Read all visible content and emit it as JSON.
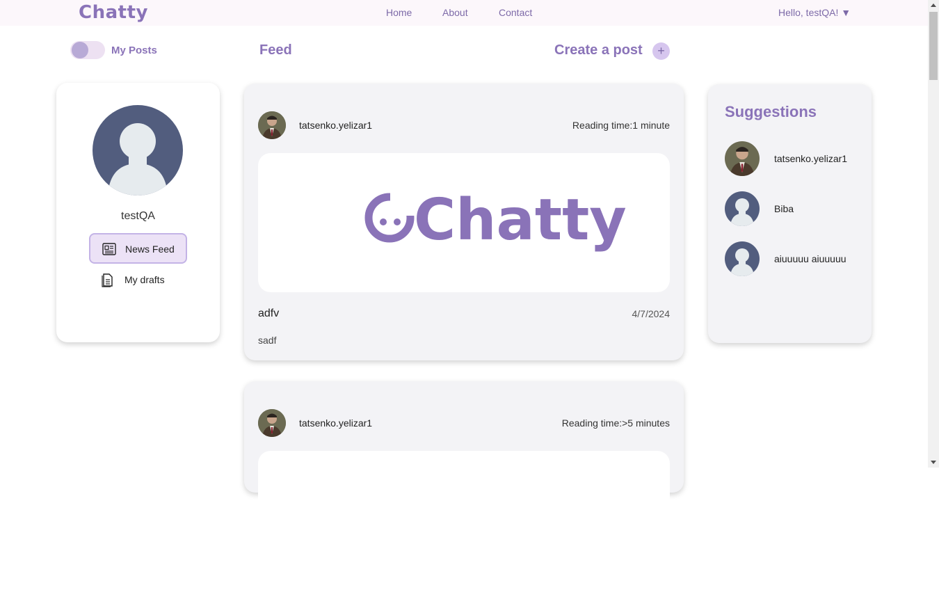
{
  "header": {
    "logo": "Chatty",
    "nav": [
      "Home",
      "About",
      "Contact"
    ],
    "greeting": "Hello, testQA! ▼"
  },
  "toolbar": {
    "toggle_label": "My Posts",
    "feed_title": "Feed",
    "create_post": "Create a post",
    "create_icon": "+"
  },
  "sidebar": {
    "username": "testQA",
    "news_feed": "News Feed",
    "my_drafts": "My drafts"
  },
  "posts": [
    {
      "author": "tatsenko.yelizar1",
      "reading_time": "Reading time:1 minute",
      "image_text": "Chatty",
      "title": "adfv",
      "date": "4/7/2024",
      "body": "sadf"
    },
    {
      "author": "tatsenko.yelizar1",
      "reading_time": "Reading time:>5 minutes"
    }
  ],
  "suggestions": {
    "title": "Suggestions",
    "users": [
      {
        "name": "tatsenko.yelizar1",
        "avatar": "photo"
      },
      {
        "name": "Biba",
        "avatar": "default"
      },
      {
        "name": "aiuuuuu aiuuuuu",
        "avatar": "default"
      }
    ]
  },
  "colors": {
    "brand": "#8a73b8",
    "avatar_bg": "#525d7e",
    "card_bg": "#f3f3f6"
  }
}
